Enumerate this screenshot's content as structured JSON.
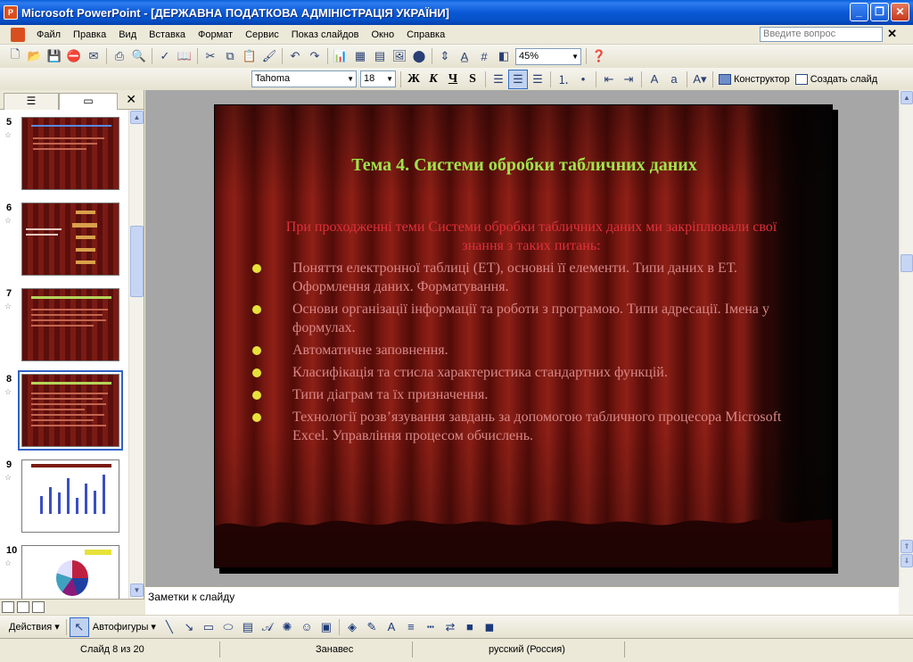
{
  "window": {
    "title": "Microsoft PowerPoint - [ДЕРЖАВНА ПОДАТКОВА АДМІНІСТРАЦІЯ УКРАЇНИ]"
  },
  "menu": {
    "items": [
      "Файл",
      "Правка",
      "Вид",
      "Вставка",
      "Формат",
      "Сервис",
      "Показ слайдов",
      "Окно",
      "Справка"
    ],
    "help_placeholder": "Введите вопрос"
  },
  "toolbar": {
    "zoom": "45%",
    "font": "Tahoma",
    "font_size": "18",
    "bold": "Ж",
    "italic": "К",
    "underline": "Ч",
    "shadow": "S",
    "designer": "Конструктор",
    "new_slide": "Создать слайд"
  },
  "thumbnails": [
    {
      "num": "5"
    },
    {
      "num": "6"
    },
    {
      "num": "7"
    },
    {
      "num": "8",
      "selected": true
    },
    {
      "num": "9"
    },
    {
      "num": "10"
    }
  ],
  "slide": {
    "title": "Тема 4. Системи обробки табличних даних",
    "intro": "При проходженні теми Системи обробки табличних даних ми закріплювали свої знання з таких питань:",
    "bullets": [
      "Поняття електронної таблиці (ЕТ), основні її елементи. Типи даних в ЕТ. Оформлення даних. Форматування.",
      "Основи організації інформації та роботи з програмою. Типи адресації. Імена у формулах.",
      "Автоматичне заповнення.",
      "Класифікація та стисла характеристика стандартних функцій.",
      "Типи діаграм та їх призначення.",
      "Технології розв’язування завдань за допомогою табличного процесора Microsoft Excel. Управління процесом обчислень."
    ]
  },
  "notes": {
    "placeholder": "Заметки к слайду"
  },
  "drawing": {
    "actions": "Действия",
    "autoshapes": "Автофигуры"
  },
  "status": {
    "slide": "Слайд 8 из 20",
    "design": "Занавес",
    "language": "русский (Россия)"
  }
}
